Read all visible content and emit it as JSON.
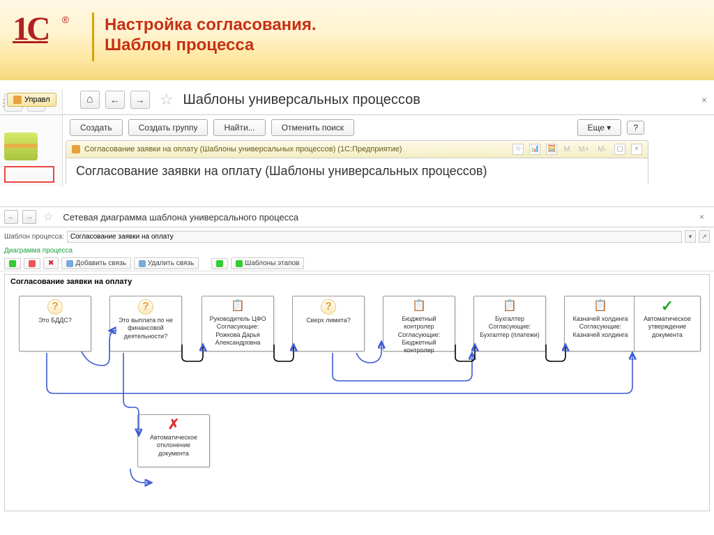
{
  "slide": {
    "title_line1": "Настройка согласования.",
    "title_line2": "Шаблон процесса",
    "logo": "1C",
    "reg": "®"
  },
  "main": {
    "tab": "Управл",
    "title": "Шаблоны универсальных процессов",
    "close_x": "×",
    "buttons": {
      "create": "Создать",
      "create_group": "Создать группу",
      "find": "Найти...",
      "cancel_search": "Отменить поиск",
      "more": "Еще",
      "help": "?"
    }
  },
  "modal": {
    "titlebar": "Согласование заявки на оплату (Шаблоны универсальных процессов) (1С:Предприятие)",
    "heading": "Согласование заявки на оплату (Шаблоны универсальных процессов)",
    "m_labels": [
      "M",
      "M+",
      "M-"
    ]
  },
  "diagram": {
    "window_title": "Сетевая диаграмма шаблона универсального процесса",
    "field_label": "Шаблон процесса:",
    "field_value": "Согласование заявки на оплату",
    "section": "Диаграмма процесса",
    "tools": {
      "add_link": "Добавить связь",
      "del_link": "Удалить связь",
      "stage_tpl": "Шаблоны этапов"
    },
    "canvas_title": "Согласование заявки на оплату",
    "nodes": [
      {
        "id": "n1",
        "type": "q",
        "text": "Это БДДС?"
      },
      {
        "id": "n2",
        "type": "q",
        "text": "Это выплата по не финансовой деятельности?"
      },
      {
        "id": "n3",
        "type": "note",
        "text": "Руководитель ЦФО Согласующие: Рожкова Дарья Александровна"
      },
      {
        "id": "n4",
        "type": "q",
        "text": "Сверх лимита?"
      },
      {
        "id": "n5",
        "type": "note",
        "text": "Бюджетный контролер Согласующие: Бюджетный контролер"
      },
      {
        "id": "n6",
        "type": "note",
        "text": "Бухгалтер Согласующие: Бухгалтер (платежи)"
      },
      {
        "id": "n7",
        "type": "note",
        "text": "Казначей холдинга Согласующие: Казначей холдинга"
      },
      {
        "id": "n8",
        "type": "check",
        "text": "Автоматическое утверждение документа"
      },
      {
        "id": "n9",
        "type": "cross",
        "text": "Автоматическое отклонение документа"
      }
    ]
  }
}
